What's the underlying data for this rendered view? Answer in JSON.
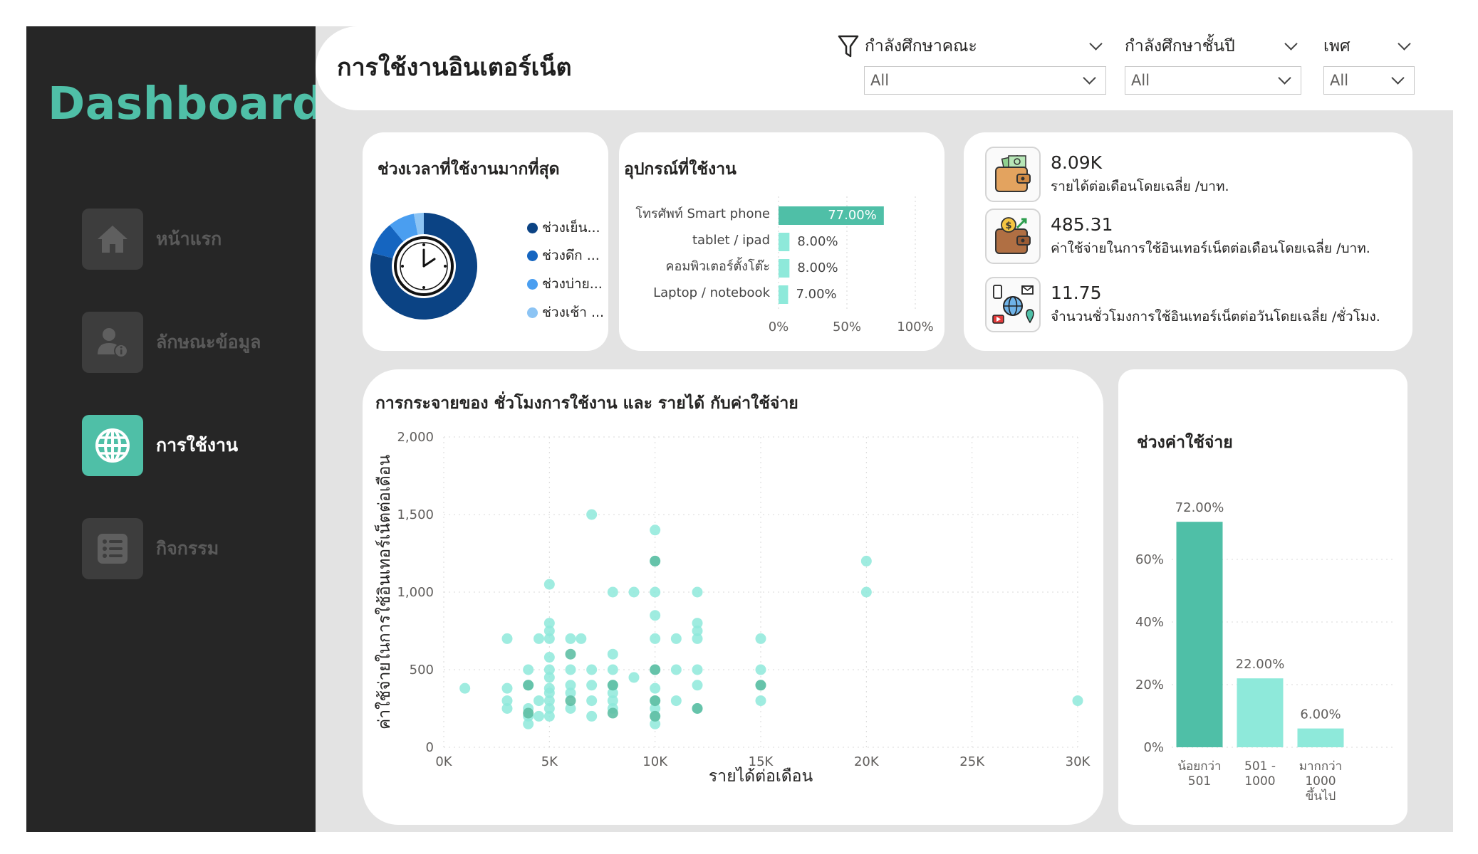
{
  "sidebar": {
    "brand": "Dashboard",
    "items": [
      {
        "label": "หน้าแรก",
        "icon": "home-icon"
      },
      {
        "label": "ลักษณะข้อมูล",
        "icon": "user-info-icon"
      },
      {
        "label": "การใช้งาน",
        "icon": "globe-icon",
        "active": true
      },
      {
        "label": "กิจกรรม",
        "icon": "list-icon"
      }
    ]
  },
  "header": {
    "title": "การใช้งานอินเตอร์เน็ต",
    "filter_icon": "filter-icon",
    "slicers": [
      {
        "label": "กำลังศึกษาคณะ",
        "value": "All"
      },
      {
        "label": "กำลังศึกษาชั้นปี",
        "value": "All"
      },
      {
        "label": "เพศ",
        "value": "All"
      }
    ]
  },
  "colors": {
    "accent": "#4fbfa7",
    "mint": "#8ee9da",
    "sidebar_bg": "#262626",
    "donut": [
      "#0b4384",
      "#1565c0",
      "#4a9ef0",
      "#8cc4f4"
    ]
  },
  "time_card": {
    "title": "ช่วงเวลาที่ใช้งานมากที่สุด",
    "center_icon": "clock-icon",
    "legend": [
      "ช่วงเย็น...",
      "ช่วงดึก ...",
      "ช่วงบ่าย...",
      "ช่วงเช้า ..."
    ]
  },
  "device_card": {
    "title": "อุปกรณ์ที่ใช้งาน",
    "x_ticks": [
      "0%",
      "50%",
      "100%"
    ]
  },
  "kpis": [
    {
      "value": "8.09K",
      "label": "รายได้ต่อเดือนโดยเฉลี่ย /บาท.",
      "icon": "wallet-money-icon"
    },
    {
      "value": "485.31",
      "label": "ค่าใช้จ่ายในการใช้อินเทอร์เน็ตต่อเดือนโดยเฉลี่ย /บาท.",
      "icon": "wallet-coin-icon"
    },
    {
      "value": "11.75",
      "label": "จำนวนชั่วโมงการใช้อินเทอร์เน็ตต่อวันโดยเฉลี่ย /ชั่วโมง.",
      "icon": "internet-devices-icon"
    }
  ],
  "scatter_card": {
    "title": "การกระจายของ ชั่วโมงการใช้งาน และ รายได้ กับค่าใช้จ่าย"
  },
  "expense_card": {
    "title": "ช่วงค่าใช้จ่าย"
  },
  "chart_data": [
    {
      "type": "pie",
      "title": "ช่วงเวลาที่ใช้งานมากที่สุด",
      "categories": [
        "ช่วงเย็น...",
        "ช่วงดึก ...",
        "ช่วงบ่าย...",
        "ช่วงเช้า ..."
      ],
      "values": [
        79,
        10,
        8,
        3
      ],
      "legend": "right"
    },
    {
      "type": "bar",
      "orientation": "horizontal",
      "title": "อุปกรณ์ที่ใช้งาน",
      "categories": [
        "โทรศัพท์ Smart phone",
        "tablet / ipad",
        "คอมพิวเตอร์ตั้งโต๊ะ",
        "Laptop / notebook"
      ],
      "values": [
        77,
        8,
        8,
        7
      ],
      "data_labels": [
        "77.00%",
        "8.00%",
        "8.00%",
        "7.00%"
      ],
      "xlim": [
        0,
        100
      ],
      "x_ticks": [
        "0%",
        "50%",
        "100%"
      ]
    },
    {
      "type": "scatter",
      "title": "การกระจายของ ชั่วโมงการใช้งาน และ รายได้ กับค่าใช้จ่าย",
      "xlabel": "รายได้ต่อเดือน",
      "ylabel": "ค่าใช้จ่ายในการใช้อินเทอร์เน็ตต่อเดือน",
      "xlim": [
        0,
        30000
      ],
      "ylim": [
        0,
        2000
      ],
      "x_ticks": [
        "0K",
        "5K",
        "10K",
        "15K",
        "20K",
        "25K",
        "30K"
      ],
      "y_ticks": [
        "0",
        "500",
        "1,000",
        "1,500",
        "2,000"
      ],
      "grid": true,
      "points": [
        [
          1000,
          380
        ],
        [
          3000,
          700
        ],
        [
          3000,
          380
        ],
        [
          3000,
          300
        ],
        [
          3000,
          250
        ],
        [
          4000,
          400
        ],
        [
          4000,
          500
        ],
        [
          4000,
          200
        ],
        [
          4000,
          150
        ],
        [
          4000,
          250
        ],
        [
          4500,
          700
        ],
        [
          4500,
          300
        ],
        [
          4500,
          200
        ],
        [
          5000,
          1050
        ],
        [
          5000,
          800
        ],
        [
          5000,
          750
        ],
        [
          5000,
          700
        ],
        [
          5000,
          580
        ],
        [
          5000,
          500
        ],
        [
          5000,
          450
        ],
        [
          5000,
          380
        ],
        [
          5000,
          350
        ],
        [
          5000,
          300
        ],
        [
          5000,
          250
        ],
        [
          5000,
          200
        ],
        [
          6000,
          700
        ],
        [
          6000,
          500
        ],
        [
          6000,
          400
        ],
        [
          6000,
          350
        ],
        [
          6000,
          250
        ],
        [
          6500,
          700
        ],
        [
          7000,
          1500
        ],
        [
          7000,
          500
        ],
        [
          7000,
          400
        ],
        [
          7000,
          300
        ],
        [
          7000,
          200
        ],
        [
          8000,
          1000
        ],
        [
          8000,
          600
        ],
        [
          8000,
          500
        ],
        [
          8000,
          400
        ],
        [
          8000,
          350
        ],
        [
          8000,
          300
        ],
        [
          8000,
          250
        ],
        [
          9000,
          1000
        ],
        [
          9000,
          450
        ],
        [
          10000,
          1400
        ],
        [
          10000,
          1200
        ],
        [
          10000,
          1000
        ],
        [
          10000,
          850
        ],
        [
          10000,
          700
        ],
        [
          10000,
          500
        ],
        [
          10000,
          380
        ],
        [
          10000,
          300
        ],
        [
          10000,
          250
        ],
        [
          10000,
          200
        ],
        [
          10000,
          150
        ],
        [
          11000,
          700
        ],
        [
          11000,
          500
        ],
        [
          11000,
          300
        ],
        [
          12000,
          1000
        ],
        [
          12000,
          800
        ],
        [
          12000,
          750
        ],
        [
          12000,
          700
        ],
        [
          12000,
          500
        ],
        [
          12000,
          400
        ],
        [
          12000,
          250
        ],
        [
          15000,
          700
        ],
        [
          15000,
          500
        ],
        [
          15000,
          400
        ],
        [
          15000,
          300
        ],
        [
          20000,
          1200
        ],
        [
          20000,
          1000
        ],
        [
          30000,
          300
        ]
      ],
      "highlight_points": [
        [
          4000,
          400
        ],
        [
          4000,
          220
        ],
        [
          6000,
          600
        ],
        [
          6000,
          300
        ],
        [
          8000,
          400
        ],
        [
          8000,
          220
        ],
        [
          10000,
          1200
        ],
        [
          10000,
          500
        ],
        [
          10000,
          300
        ],
        [
          10000,
          200
        ],
        [
          12000,
          250
        ],
        [
          15000,
          400
        ]
      ]
    },
    {
      "type": "bar",
      "title": "ช่วงค่าใช้จ่าย",
      "categories": [
        "น้อยกว่า 501",
        "501 - 1000",
        "มากกว่า 1000 ขึ้นไป"
      ],
      "values": [
        72,
        22,
        6
      ],
      "data_labels": [
        "72.00%",
        "22.00%",
        "6.00%"
      ],
      "ylim": [
        0,
        80
      ],
      "y_ticks": [
        "0%",
        "20%",
        "40%",
        "60%"
      ],
      "grid": true
    }
  ]
}
